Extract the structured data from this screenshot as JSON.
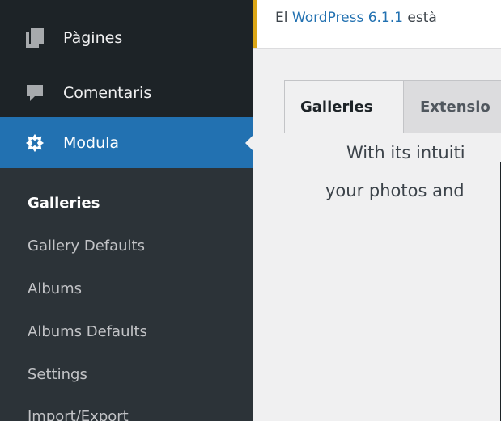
{
  "sidebar": {
    "items": [
      {
        "label": "Pàgines",
        "icon": "pages-icon"
      },
      {
        "label": "Comentaris",
        "icon": "comments-icon"
      },
      {
        "label": "Modula",
        "icon": "modula-icon",
        "active": true
      }
    ],
    "submenu": [
      {
        "label": "Galleries",
        "current": true
      },
      {
        "label": "Gallery Defaults"
      },
      {
        "label": "Albums"
      },
      {
        "label": "Albums Defaults"
      },
      {
        "label": "Settings"
      },
      {
        "label": "Import/Export"
      }
    ]
  },
  "notice": {
    "prefix": "El ",
    "link": "WordPress 6.1.1",
    "suffix": " està"
  },
  "tabs": [
    {
      "label": "Galleries",
      "active": true
    },
    {
      "label": "Extensio"
    }
  ],
  "content": {
    "line1": "With its intuiti",
    "line2": "your photos and"
  },
  "colors": {
    "sidebar_bg": "#1d2327",
    "submenu_bg": "#2c3338",
    "accent": "#2271b1",
    "notice_border": "#dba617"
  }
}
